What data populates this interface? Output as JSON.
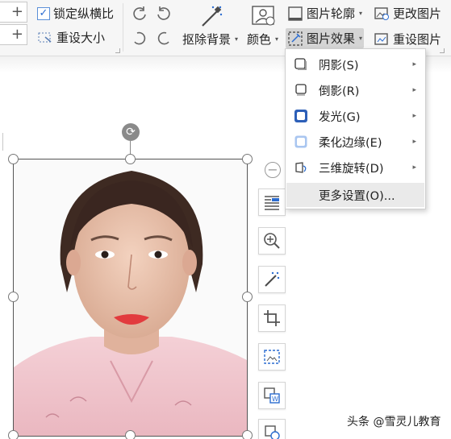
{
  "ribbon": {
    "lock_ratio_label": "锁定纵横比",
    "lock_ratio_checked": true,
    "reset_size_label": "重设大小",
    "remove_bg_label": "抠除背景",
    "color_label": "颜色",
    "outline_label": "图片轮廓",
    "effects_label": "图片效果",
    "change_pic_label": "更改图片",
    "reset_pic_label": "重设图片",
    "spin_plus": "+"
  },
  "effects_menu": {
    "items": [
      {
        "label": "阴影(S)",
        "icon": "shadow-icon",
        "has_submenu": true
      },
      {
        "label": "倒影(R)",
        "icon": "reflection-icon",
        "has_submenu": true
      },
      {
        "label": "发光(G)",
        "icon": "glow-icon",
        "has_submenu": true
      },
      {
        "label": "柔化边缘(E)",
        "icon": "soft-edge-icon",
        "has_submenu": true
      },
      {
        "label": "三维旋转(D)",
        "icon": "3d-rotation-icon",
        "has_submenu": true
      }
    ],
    "more_settings": "更多设置(O)...",
    "submenu_arrow": "▸"
  },
  "side_toolbar": [
    "collapse-icon",
    "layout-options-icon",
    "zoom-icon",
    "remove-bg-icon",
    "crop-icon",
    "image-adjust-icon",
    "convert-to-word-icon",
    "more-icon"
  ],
  "watermark": "头条 @雪灵儿教育",
  "colors": {
    "ribbon_bg": "#f6f6f6",
    "menu_highlight": "#eaeaea",
    "glow_blue": "#2d5fb8",
    "shirt_pink": "#f0c4cb"
  }
}
